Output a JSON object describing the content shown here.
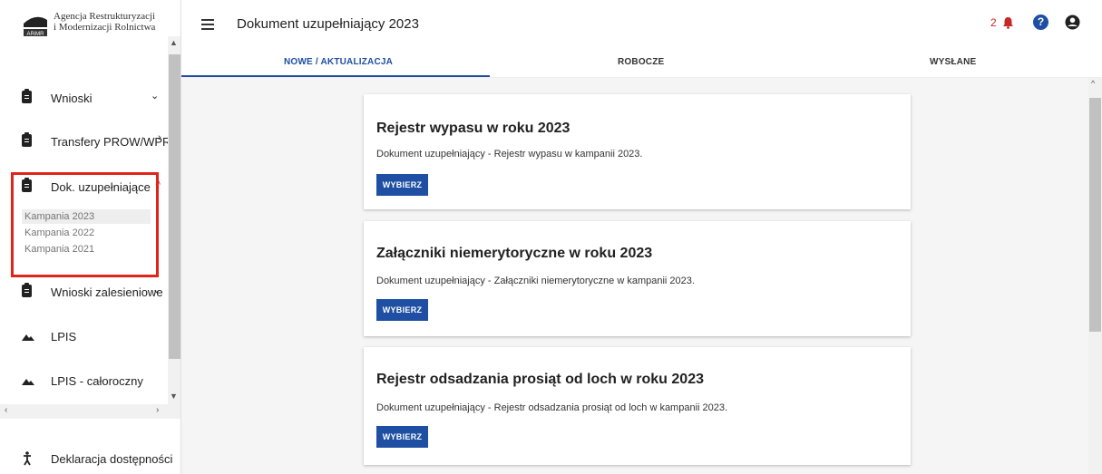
{
  "logo": {
    "line1": "Agencja Restrukturyzacji",
    "line2": "i Modernizacji Rolnictwa",
    "badge": "ARiMR"
  },
  "sidebar": {
    "items": [
      {
        "label": "Wnioski",
        "icon": "clipboard-icon",
        "chevron": "⌄"
      },
      {
        "label": "Transfery PROW/WPR",
        "icon": "clipboard-icon",
        "chevron": "›"
      },
      {
        "label": "Dok. uzupełniające",
        "icon": "clipboard-icon",
        "chevron": "˄"
      },
      {
        "label": "Wnioski zalesieniowe",
        "icon": "clipboard-icon",
        "chevron": "⌄"
      },
      {
        "label": "LPIS",
        "icon": "terrain-icon"
      },
      {
        "label": "LPIS - całoroczny",
        "icon": "terrain-icon"
      },
      {
        "label": "Deklaracja dostępności",
        "icon": "accessibility-icon"
      }
    ],
    "sub_items": [
      {
        "label": "Kampania 2023",
        "active": true
      },
      {
        "label": "Kampania 2022",
        "active": false
      },
      {
        "label": "Kampania 2021",
        "active": false
      }
    ],
    "highlight_color": "#e2231a"
  },
  "header": {
    "title": "Dokument uzupełniający 2023",
    "notification_count": "2"
  },
  "tabs": [
    {
      "label": "NOWE / AKTUALIZACJA",
      "active": true
    },
    {
      "label": "ROBOCZE",
      "active": false
    },
    {
      "label": "WYSŁANE",
      "active": false
    }
  ],
  "cards": [
    {
      "title": "Rejestr wypasu w roku 2023",
      "description": "Dokument uzupełniający - Rejestr wypasu w kampanii 2023.",
      "button": "WYBIERZ"
    },
    {
      "title": "Załączniki niemerytoryczne w roku 2023",
      "description": "Dokument uzupełniający - Załączniki niemerytoryczne w kampanii 2023.",
      "button": "WYBIERZ"
    },
    {
      "title": "Rejestr odsadzania prosiąt od loch w roku 2023",
      "description": "Dokument uzupełniający - Rejestr odsadzania prosiąt od loch w kampanii 2023.",
      "button": "WYBIERZ"
    }
  ],
  "colors": {
    "accent": "#1e4fa3",
    "notification": "#c62828"
  }
}
